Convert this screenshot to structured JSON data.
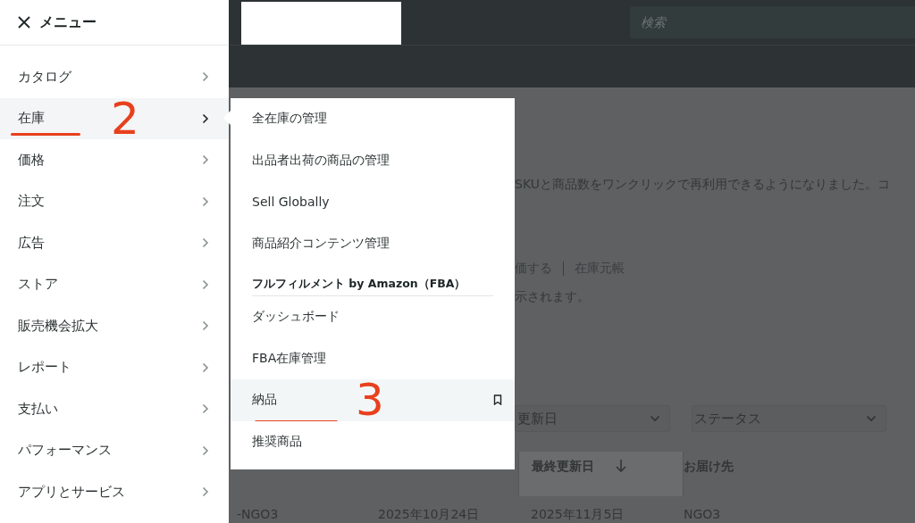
{
  "header": {
    "search": {
      "placeholder": "検索"
    }
  },
  "page": {
    "notice": "SKUと商品数をワンクリックで再利用できるようになりました。コ",
    "links": [
      "価する",
      "在庫元帳"
    ],
    "info": "示されます。",
    "filters": [
      {
        "label": "更新日"
      },
      {
        "label": "ステータス"
      }
    ],
    "table": {
      "columns": [
        {},
        {},
        {
          "label": "最終更新日",
          "sorted": true
        },
        {
          "label": "お届け先",
          "sorted": false
        }
      ],
      "rows": [
        [
          "-NGO3",
          "2025年10月24日",
          "2025年11月5日",
          "NGO3"
        ]
      ]
    }
  },
  "sidebar": {
    "title": "メニュー",
    "items": [
      {
        "label": "カタログ",
        "selected": false,
        "underlined": false
      },
      {
        "label": "在庫",
        "selected": true,
        "underlined": true,
        "mark": "2"
      },
      {
        "label": "価格",
        "selected": false,
        "underlined": false
      },
      {
        "label": "注文",
        "selected": false,
        "underlined": false
      },
      {
        "label": "広告",
        "selected": false,
        "underlined": false
      },
      {
        "label": "ストア",
        "selected": false,
        "underlined": false
      },
      {
        "label": "販売機会拡大",
        "selected": false,
        "underlined": false
      },
      {
        "label": "レポート",
        "selected": false,
        "underlined": false
      },
      {
        "label": "支払い",
        "selected": false,
        "underlined": false
      },
      {
        "label": "パフォーマンス",
        "selected": false,
        "underlined": false
      },
      {
        "label": "アプリとサービス",
        "selected": false,
        "underlined": false
      }
    ]
  },
  "flyout": {
    "items": [
      {
        "kind": "link",
        "label": "全在庫の管理",
        "selected": false,
        "underlined": false
      },
      {
        "kind": "link",
        "label": "出品者出荷の商品の管理",
        "selected": false,
        "underlined": false
      },
      {
        "kind": "link",
        "label": "Sell Globally",
        "selected": false,
        "underlined": false
      },
      {
        "kind": "link",
        "label": "商品紹介コンテンツ管理",
        "selected": false,
        "underlined": false
      },
      {
        "kind": "heading",
        "label": "フルフィルメント by Amazon（FBA）"
      },
      {
        "kind": "link",
        "label": "ダッシュボード",
        "selected": false,
        "underlined": false
      },
      {
        "kind": "link",
        "label": "FBA在庫管理",
        "selected": false,
        "underlined": false
      },
      {
        "kind": "link",
        "label": "納品",
        "selected": true,
        "underlined": true,
        "mark": "3"
      },
      {
        "kind": "link",
        "label": "推奨商品",
        "selected": false,
        "underlined": false
      }
    ]
  }
}
